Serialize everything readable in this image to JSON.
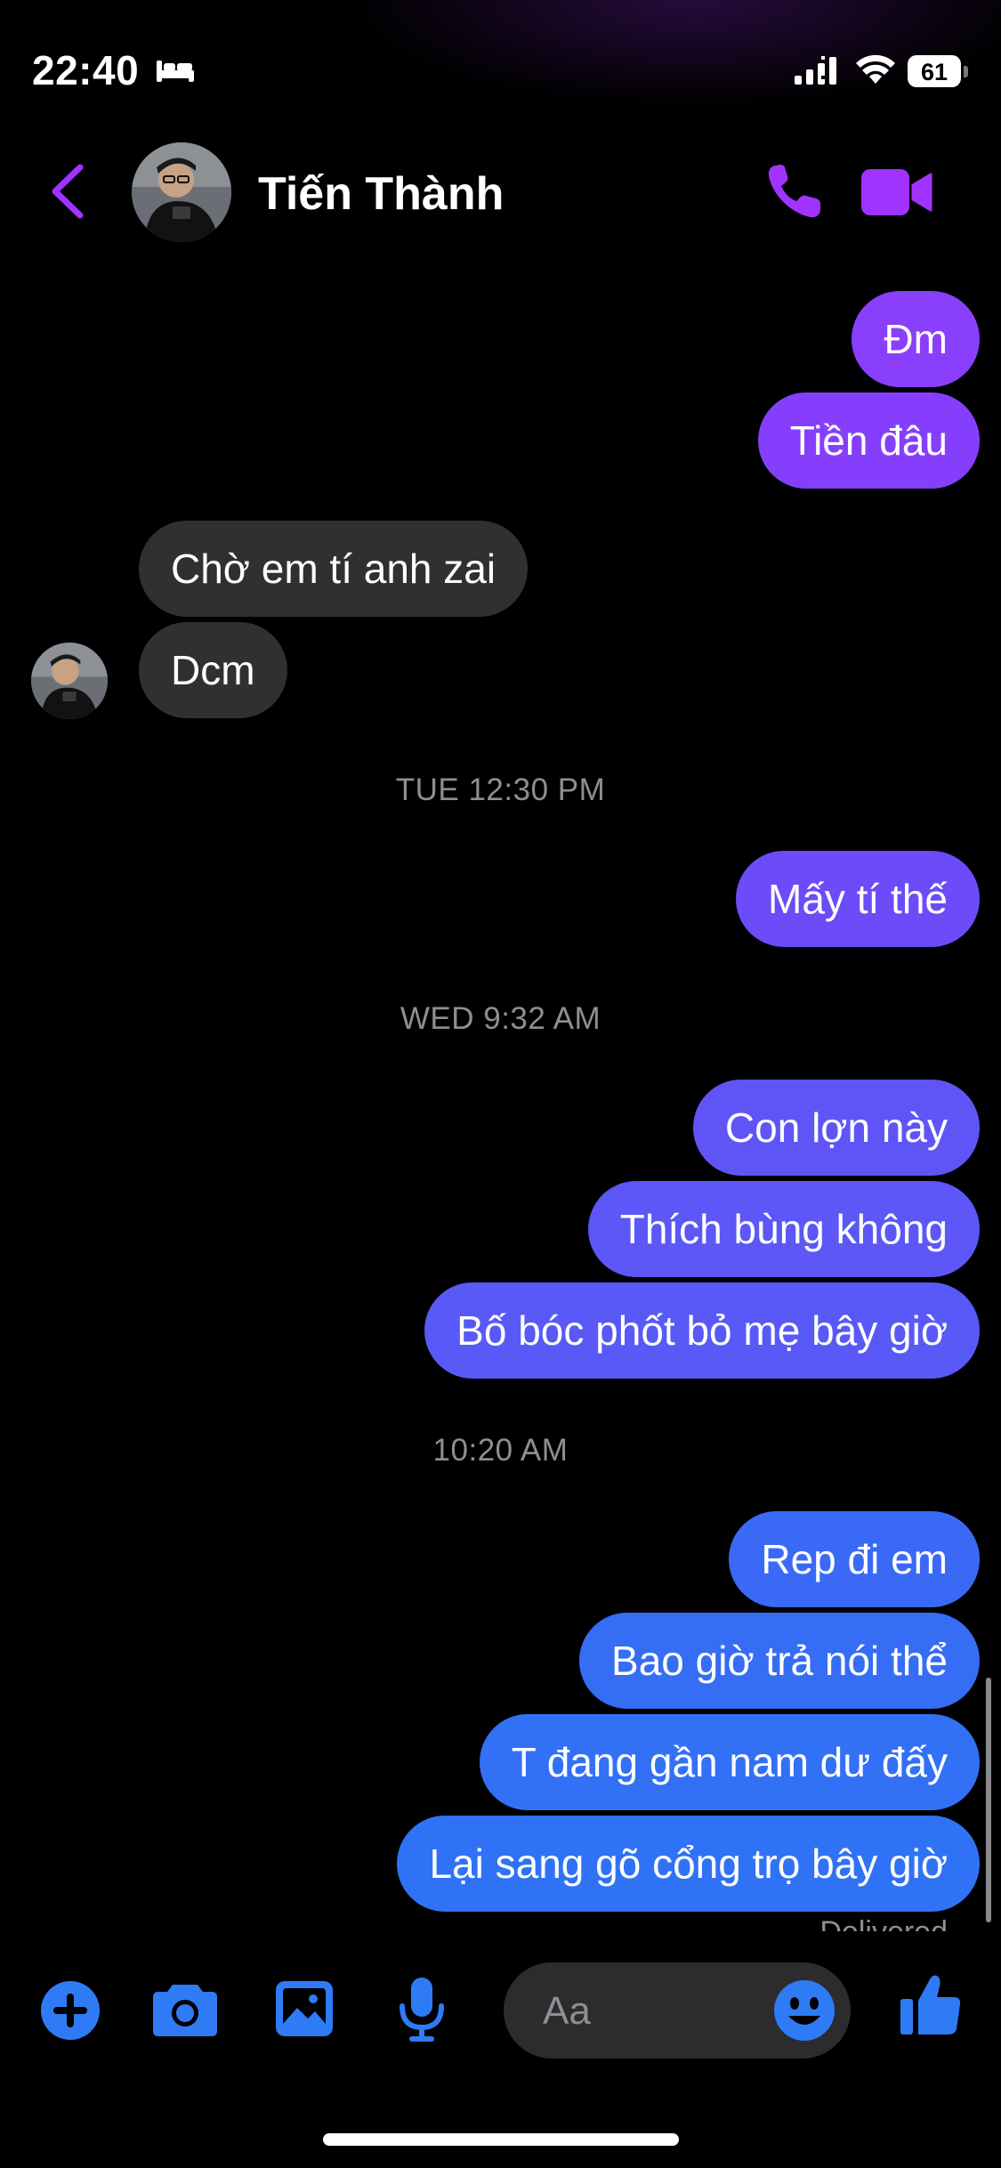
{
  "status_bar": {
    "time": "22:40",
    "battery": "61",
    "icons": [
      "bed-icon",
      "signal-icon",
      "wifi-icon",
      "battery-icon"
    ]
  },
  "header": {
    "contact_name": "Tiến Thành",
    "actions": [
      "back-icon",
      "phone-icon",
      "video-camera-icon"
    ]
  },
  "messages": [
    {
      "dir": "out",
      "text": "Đm"
    },
    {
      "dir": "out",
      "text": "Tiền đâu"
    },
    {
      "dir": "in",
      "text": "Chờ em tí anh zai"
    },
    {
      "dir": "in",
      "text": "Dcm"
    },
    {
      "timestamp": "TUE 12:30 PM"
    },
    {
      "dir": "out",
      "text": "Mấy tí thế"
    },
    {
      "timestamp": "WED 9:32 AM"
    },
    {
      "dir": "out",
      "text": "Con lợn này"
    },
    {
      "dir": "out",
      "text": "Thích bùng không"
    },
    {
      "dir": "out",
      "text": "Bố bóc phốt bỏ mẹ bây giờ"
    },
    {
      "timestamp": "10:20 AM"
    },
    {
      "dir": "out",
      "text": "Rep đi em"
    },
    {
      "dir": "out",
      "text": "Bao giờ trả nói thể"
    },
    {
      "dir": "out",
      "text": "T đang gần nam dư đấy"
    },
    {
      "dir": "out",
      "text": "Lại sang gõ cổng trọ bây giờ"
    }
  ],
  "delivered_label": "Delivered",
  "composer": {
    "placeholder": "Aa",
    "icons": [
      "plus-icon",
      "camera-icon",
      "image-icon",
      "microphone-icon",
      "emoji-icon",
      "thumbs-up-icon"
    ]
  },
  "colors": {
    "background": "#000000",
    "incoming_bubble": "#303030",
    "outgoing_purple": "#8A3FFC",
    "outgoing_indigo": "#5C55F6",
    "outgoing_blue": "#3170F5",
    "accent_purple": "#A033FF",
    "accent_blue": "#2F7BF5",
    "meta_text": "#8E8E93"
  }
}
